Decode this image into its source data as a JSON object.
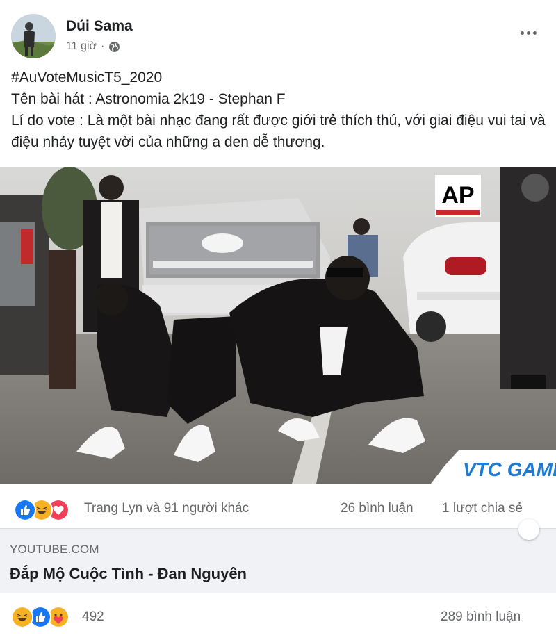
{
  "post": {
    "author": "Dúi Sama",
    "time": "11 giờ",
    "hashtag": "#AuVoteMusicT5_2020",
    "song_line": "Tên bài hát : Astronomia 2k19 - Stephan F",
    "reason_line": "Lí do vote : Là một bài nhạc đang rất được giới trẻ thích thú, với giai điệu vui tai và điệu nhảy tuyệt vời của những a den dễ thương."
  },
  "video": {
    "ap_logo": "AP",
    "watermark": "VTC GAME"
  },
  "reactions": {
    "icons": [
      "like-icon",
      "haha-icon",
      "love-icon"
    ],
    "names": "Trang Lyn và 91 người khác",
    "comments": "26 bình luận",
    "shares": "1 lượt chia sẻ"
  },
  "link_preview": {
    "domain": "YOUTUBE.COM",
    "title": "Đắp Mộ Cuộc Tình - Đan Nguyên"
  },
  "bottom": {
    "icons": [
      "haha-icon",
      "like-icon",
      "care-icon"
    ],
    "count": "492",
    "comments": "289 bình luận"
  },
  "colors": {
    "like": "#1877f2",
    "love": "#f33e58",
    "haha": "#f7b125",
    "secondary_text": "#65676b",
    "preview_bg": "#f0f2f5"
  }
}
